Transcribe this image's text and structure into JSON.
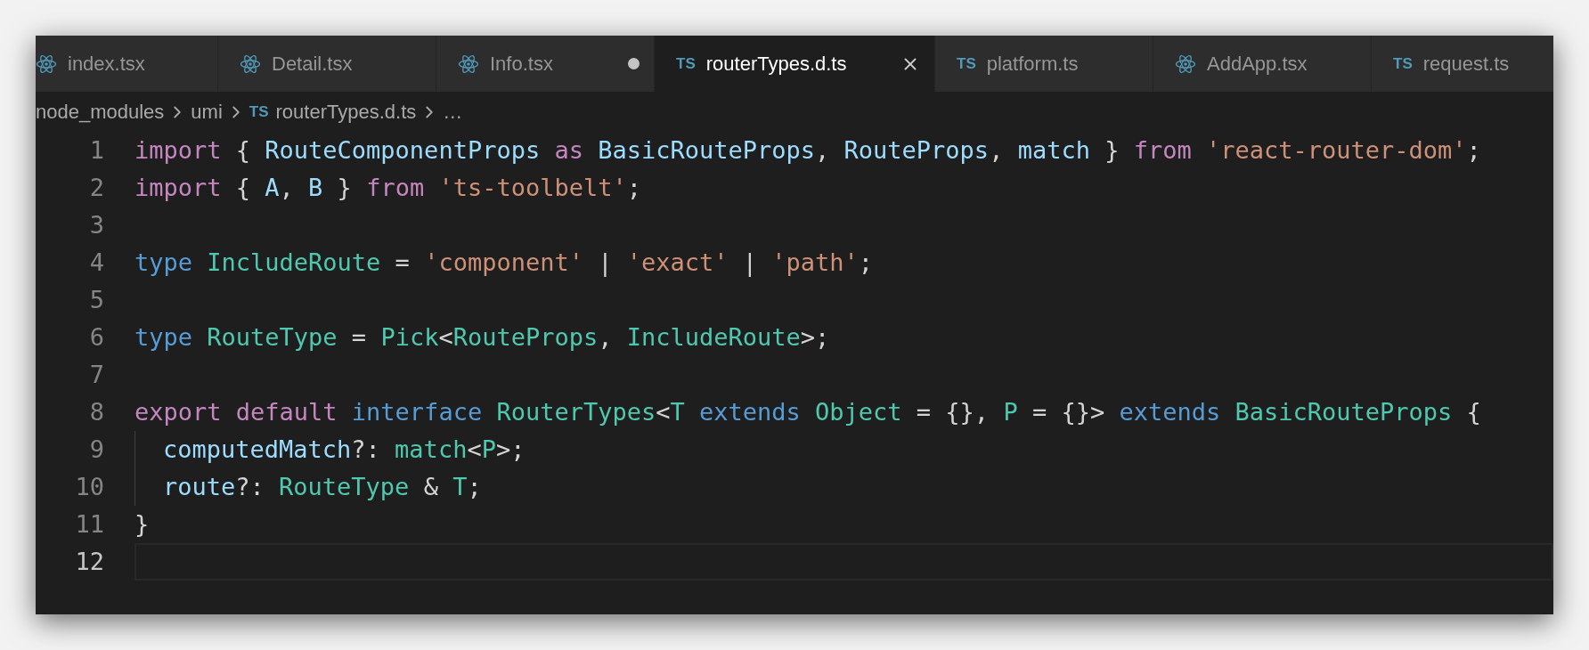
{
  "tabs": [
    {
      "label": "index.tsx",
      "kind": "react",
      "selected": false,
      "modified": false
    },
    {
      "label": "Detail.tsx",
      "kind": "react",
      "selected": false,
      "modified": false
    },
    {
      "label": "Info.tsx",
      "kind": "react",
      "selected": false,
      "modified": true
    },
    {
      "label": "routerTypes.d.ts",
      "kind": "ts",
      "badge": "TS",
      "selected": true,
      "modified": false
    },
    {
      "label": "platform.ts",
      "kind": "ts",
      "badge": "TS",
      "selected": false,
      "modified": false
    },
    {
      "label": "AddApp.tsx",
      "kind": "react",
      "selected": false,
      "modified": false
    },
    {
      "label": "request.ts",
      "kind": "ts",
      "badge": "TS",
      "selected": false,
      "modified": false
    }
  ],
  "breadcrumb": [
    {
      "label": "node_modules"
    },
    {
      "label": "umi"
    },
    {
      "label": "routerTypes.d.ts",
      "badge": "TS"
    },
    {
      "label": "…"
    }
  ],
  "editor": {
    "lines": [
      {
        "number": "1",
        "current": false,
        "indent": false,
        "tokens": [
          {
            "t": "import ",
            "kind": "keyword"
          },
          {
            "t": "{ ",
            "kind": "plain"
          },
          {
            "t": "RouteComponentProps ",
            "kind": "variable"
          },
          {
            "t": "as ",
            "kind": "keyword"
          },
          {
            "t": "BasicRouteProps",
            "kind": "variable"
          },
          {
            "t": ", ",
            "kind": "plain"
          },
          {
            "t": "RouteProps",
            "kind": "variable"
          },
          {
            "t": ", ",
            "kind": "plain"
          },
          {
            "t": "match",
            "kind": "variable"
          },
          {
            "t": " } ",
            "kind": "plain"
          },
          {
            "t": "from ",
            "kind": "keyword"
          },
          {
            "t": "'react-router-dom'",
            "kind": "string"
          },
          {
            "t": ";",
            "kind": "plain"
          }
        ]
      },
      {
        "number": "2",
        "current": false,
        "indent": false,
        "tokens": [
          {
            "t": "import ",
            "kind": "keyword"
          },
          {
            "t": "{ ",
            "kind": "plain"
          },
          {
            "t": "A",
            "kind": "variable"
          },
          {
            "t": ", ",
            "kind": "plain"
          },
          {
            "t": "B",
            "kind": "variable"
          },
          {
            "t": " } ",
            "kind": "plain"
          },
          {
            "t": "from ",
            "kind": "keyword"
          },
          {
            "t": "'ts-toolbelt'",
            "kind": "string"
          },
          {
            "t": ";",
            "kind": "plain"
          }
        ]
      },
      {
        "number": "3",
        "current": false,
        "indent": false
      },
      {
        "number": "4",
        "current": false,
        "indent": false,
        "tokens": [
          {
            "t": "type ",
            "kind": "storage"
          },
          {
            "t": "IncludeRoute",
            "kind": "type"
          },
          {
            "t": " = ",
            "kind": "plain"
          },
          {
            "t": "'component'",
            "kind": "string"
          },
          {
            "t": " | ",
            "kind": "plain"
          },
          {
            "t": "'exact'",
            "kind": "string"
          },
          {
            "t": " | ",
            "kind": "plain"
          },
          {
            "t": "'path'",
            "kind": "string"
          },
          {
            "t": ";",
            "kind": "plain"
          }
        ]
      },
      {
        "number": "5",
        "current": false,
        "indent": false
      },
      {
        "number": "6",
        "current": false,
        "indent": false,
        "tokens": [
          {
            "t": "type ",
            "kind": "storage"
          },
          {
            "t": "RouteType",
            "kind": "type"
          },
          {
            "t": " = ",
            "kind": "plain"
          },
          {
            "t": "Pick",
            "kind": "type"
          },
          {
            "t": "<",
            "kind": "plain"
          },
          {
            "t": "RouteProps",
            "kind": "type"
          },
          {
            "t": ", ",
            "kind": "plain"
          },
          {
            "t": "IncludeRoute",
            "kind": "type"
          },
          {
            "t": ">;",
            "kind": "plain"
          }
        ]
      },
      {
        "number": "7",
        "current": false,
        "indent": false
      },
      {
        "number": "8",
        "current": false,
        "indent": false,
        "tokens": [
          {
            "t": "export ",
            "kind": "keyword"
          },
          {
            "t": "default ",
            "kind": "keyword"
          },
          {
            "t": "interface ",
            "kind": "storage"
          },
          {
            "t": "RouterTypes",
            "kind": "type"
          },
          {
            "t": "<",
            "kind": "plain"
          },
          {
            "t": "T ",
            "kind": "type"
          },
          {
            "t": "extends ",
            "kind": "storage"
          },
          {
            "t": "Object",
            "kind": "type"
          },
          {
            "t": " = {}, ",
            "kind": "plain"
          },
          {
            "t": "P",
            "kind": "type"
          },
          {
            "t": " = {}> ",
            "kind": "plain"
          },
          {
            "t": "extends ",
            "kind": "storage"
          },
          {
            "t": "BasicRouteProps",
            "kind": "type"
          },
          {
            "t": " {",
            "kind": "plain"
          }
        ]
      },
      {
        "number": "9",
        "current": false,
        "indent": true,
        "tokens": [
          {
            "t": "computedMatch",
            "kind": "variable"
          },
          {
            "t": "?: ",
            "kind": "plain"
          },
          {
            "t": "match",
            "kind": "type"
          },
          {
            "t": "<",
            "kind": "plain"
          },
          {
            "t": "P",
            "kind": "type"
          },
          {
            "t": ">;",
            "kind": "plain"
          }
        ]
      },
      {
        "number": "10",
        "current": false,
        "indent": true,
        "tokens": [
          {
            "t": "route",
            "kind": "variable"
          },
          {
            "t": "?: ",
            "kind": "plain"
          },
          {
            "t": "RouteType",
            "kind": "type"
          },
          {
            "t": " & ",
            "kind": "plain"
          },
          {
            "t": "T",
            "kind": "type"
          },
          {
            "t": ";",
            "kind": "plain"
          }
        ]
      },
      {
        "number": "11",
        "current": false,
        "indent": false,
        "tokens": [
          {
            "t": "}",
            "kind": "plain"
          }
        ]
      },
      {
        "number": "12",
        "current": true,
        "indent": false
      }
    ]
  }
}
